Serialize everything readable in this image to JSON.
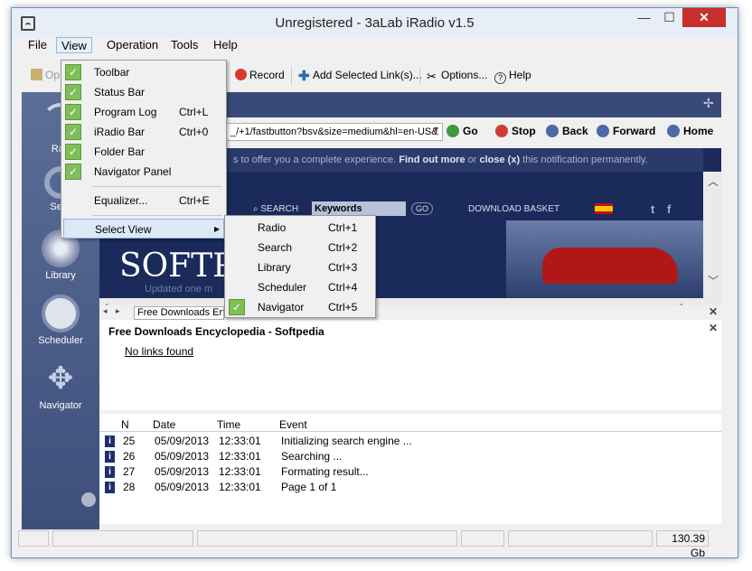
{
  "window": {
    "title": "Unregistered - 3aLab iRadio v1.5",
    "controls": {
      "minimize": "—",
      "maximize": "☐",
      "close": "✕"
    }
  },
  "menubar": {
    "items": [
      "File",
      "View",
      "Operation",
      "Tools",
      "Help"
    ]
  },
  "toolbar": {
    "open": "Op",
    "record": "Record",
    "add_links": "Add Selected Link(s)...",
    "options": "Options...",
    "help": "Help"
  },
  "navigator": {
    "items": [
      "Rad",
      "Sear",
      "Library",
      "Scheduler",
      "Navigator"
    ]
  },
  "address": {
    "url": "_/+1/fastbutton?bsv&size=medium&hl=en-US&",
    "go": "Go",
    "stop": "Stop",
    "back": "Back",
    "forward": "Forward",
    "home": "Home"
  },
  "browser": {
    "notification": {
      "text": "s to offer you a complete experience.",
      "find_out_more": "Find out more",
      "or": "or",
      "close": "close (x)",
      "suffix": "this notification permanently."
    },
    "search_label": "SEARCH",
    "keywords": "Keywords",
    "go": "GO",
    "download_basket": "DOWNLOAD BASKET",
    "logo": "SOFTP",
    "tagline": "Updated one m",
    "twitter": "t",
    "facebook": "f"
  },
  "tabs": {
    "active": "Free Downloads En"
  },
  "links": {
    "title": "Free Downloads Encyclopedia - Softpedia",
    "empty": "No links found"
  },
  "log": {
    "columns": [
      "N",
      "Date",
      "Time",
      "Event"
    ],
    "rows": [
      {
        "n": "25",
        "date": "05/09/2013",
        "time": "12:33:01",
        "event": "Initializing search engine ..."
      },
      {
        "n": "26",
        "date": "05/09/2013",
        "time": "12:33:01",
        "event": "Searching ..."
      },
      {
        "n": "27",
        "date": "05/09/2013",
        "time": "12:33:01",
        "event": "Formating result..."
      },
      {
        "n": "28",
        "date": "05/09/2013",
        "time": "12:33:01",
        "event": "Page 1 of 1"
      }
    ]
  },
  "status": {
    "disk": "130.39 Gb"
  },
  "view_menu": {
    "items": [
      {
        "label": "Toolbar",
        "shortcut": "",
        "checked": true
      },
      {
        "label": "Status Bar",
        "shortcut": "",
        "checked": true
      },
      {
        "label": "Program Log",
        "shortcut": "Ctrl+L",
        "checked": true
      },
      {
        "label": "iRadio Bar",
        "shortcut": "Ctrl+0",
        "checked": true
      },
      {
        "label": "Folder Bar",
        "shortcut": "",
        "checked": true
      },
      {
        "label": "Navigator Panel",
        "shortcut": "",
        "checked": true
      },
      {
        "label": "Equalizer...",
        "shortcut": "Ctrl+E",
        "checked": false
      },
      {
        "label": "Select View",
        "shortcut": "",
        "checked": false
      }
    ],
    "submenu_arrow": "▶"
  },
  "select_view_menu": {
    "items": [
      {
        "label": "Radio",
        "shortcut": "Ctrl+1",
        "checked": false
      },
      {
        "label": "Search",
        "shortcut": "Ctrl+2",
        "checked": false
      },
      {
        "label": "Library",
        "shortcut": "Ctrl+3",
        "checked": false
      },
      {
        "label": "Scheduler",
        "shortcut": "Ctrl+4",
        "checked": false
      },
      {
        "label": "Navigator",
        "shortcut": "Ctrl+5",
        "checked": true
      }
    ]
  },
  "colors": {
    "nav_panel": "#4a5d8a",
    "header": "#3a4a78",
    "check": "#7fbf5a",
    "close_btn": "#c7302b"
  }
}
